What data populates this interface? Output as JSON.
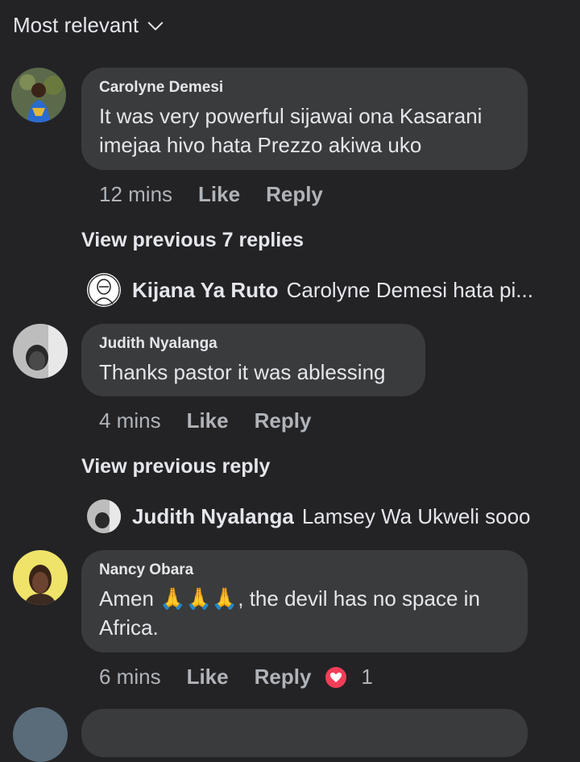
{
  "sort": {
    "label": "Most relevant",
    "icon": "chevron-down-icon"
  },
  "comments": [
    {
      "author": "Carolyne Demesi",
      "text_line1": "It was very powerful sijawai ona Kasarani",
      "text_line2": "imejaa hivo hata Prezzo akiwa uko",
      "time": "12 mins",
      "like": "Like",
      "reply": "Reply",
      "view_previous": "View previous 7 replies",
      "preview_name": "Kijana Ya Ruto",
      "preview_text": "Carolyne Demesi hata pi..."
    },
    {
      "author": "Judith Nyalanga",
      "text_line1": "Thanks pastor it was ablessing",
      "time": "4 mins",
      "like": "Like",
      "reply": "Reply",
      "view_previous": "View previous reply",
      "preview_name": "Judith Nyalanga",
      "preview_text": "Lamsey Wa Ukweli sooo"
    },
    {
      "author": "Nancy Obara",
      "text_line1": "Amen 🙏🙏🙏, the devil has no space in",
      "text_line2": "Africa.",
      "time": "6 mins",
      "like": "Like",
      "reply": "Reply",
      "reaction_count": "1"
    }
  ],
  "colors": {
    "background": "#232326",
    "bubble": "#3a3b3c",
    "muted": "#b0b3b8",
    "text": "#e4e6eb",
    "heart": "#f33e58"
  }
}
